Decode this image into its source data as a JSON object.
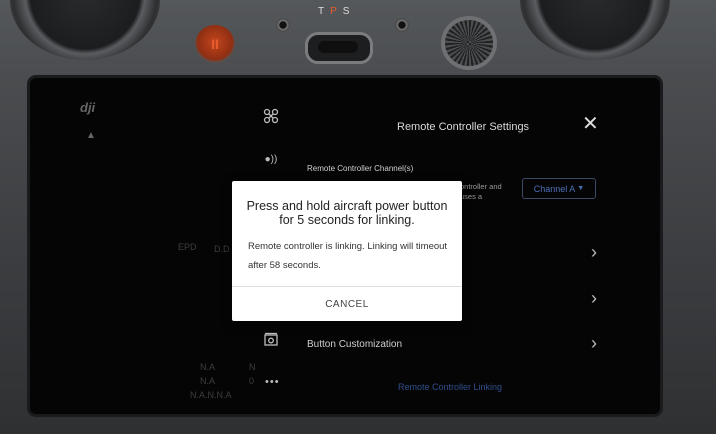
{
  "hardware": {
    "mode_switch_labels": [
      "T",
      "P",
      "S"
    ],
    "pause_button_glyph": "II"
  },
  "screen": {
    "logo": "dji",
    "left_panel": {
      "faint_lines": [
        "EPD",
        "D.D",
        "N.A",
        "N.A",
        "N.A.N.N.A",
        "N",
        "0"
      ]
    },
    "nav_icons": [
      "drone-icon",
      "signal-icon",
      "camera-icon",
      "more-icon"
    ],
    "settings_title": "Remote Controller Settings",
    "channel_section": {
      "label": "Remote Controller Channel(s)",
      "description": "ontroller and\nuses a",
      "select_value": "Channel A"
    },
    "button_customization_label": "Button Customization",
    "rc_linking_label": "Remote Controller Linking",
    "accent_color": "#4d6fb7"
  },
  "dialog": {
    "title": "Press and hold aircraft power button for 5 seconds for linking.",
    "message": "Remote controller is linking. Linking will timeout after 58 seconds.",
    "cancel_label": "CANCEL"
  }
}
